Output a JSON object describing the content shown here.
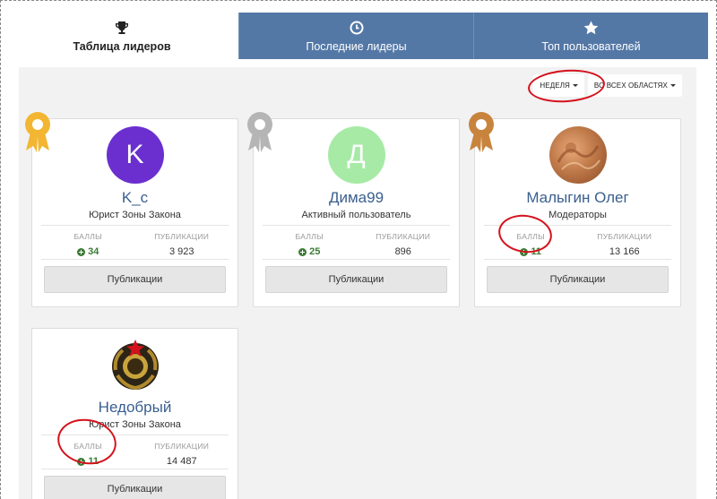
{
  "tabs": [
    {
      "label": "Таблица лидеров",
      "icon": "trophy-icon",
      "active": true
    },
    {
      "label": "Последние лидеры",
      "icon": "clock-icon",
      "active": false
    },
    {
      "label": "Топ пользователей",
      "icon": "star-icon",
      "active": false
    }
  ],
  "filters": {
    "period": "НЕДЕЛЯ",
    "area": "ВО ВСЕХ ОБЛАСТЯХ"
  },
  "stat_labels": {
    "points": "БАЛЛЫ",
    "posts": "ПУБЛИКАЦИИ"
  },
  "cards": [
    {
      "name": "K_c",
      "role": "Юрист Зоны Закона",
      "avatar_letter": "K",
      "avatar_color": "#6b2fcf",
      "points": "34",
      "posts": "3 923",
      "button": "Публикации",
      "medal": "gold",
      "medal_color": "#f2b632"
    },
    {
      "name": "Дима99",
      "role": "Активный пользователь",
      "avatar_letter": "Д",
      "avatar_color": "#a6eaa6",
      "points": "25",
      "posts": "896",
      "button": "Публикации",
      "medal": "silver",
      "medal_color": "#b5b5b5"
    },
    {
      "name": "Малыгин Олег",
      "role": "Модераторы",
      "avatar_letter": "",
      "avatar_color": "#c98552",
      "points": "11",
      "posts": "13 166",
      "button": "Публикации",
      "medal": "bronze",
      "medal_color": "#c8843d"
    },
    {
      "name": "Недобрый",
      "role": "Юрист Зоны Закона",
      "avatar_letter": "",
      "avatar_color": "#3a2a12",
      "points": "11",
      "posts": "14 487",
      "button": "Публикации",
      "medal": "",
      "medal_color": ""
    }
  ],
  "colors": {
    "tab_inactive": "#5478a6",
    "name_link": "#3a5f8f",
    "points_green": "#3b7a36",
    "annotation_red": "#d4121c"
  }
}
